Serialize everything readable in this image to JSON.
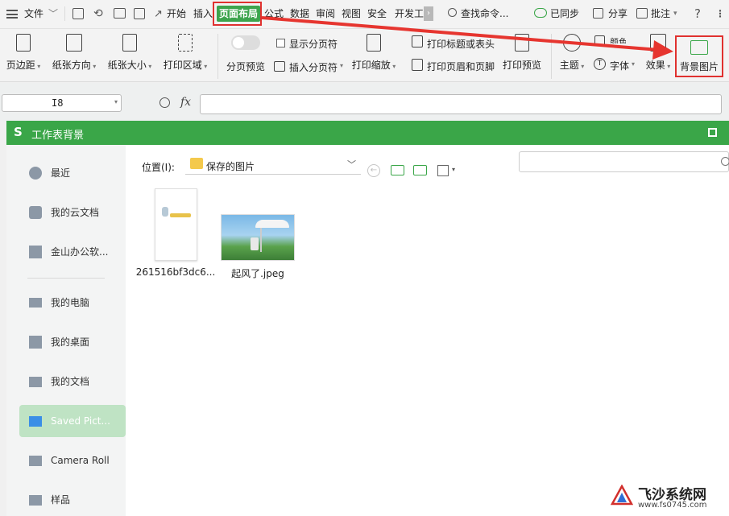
{
  "menu": {
    "file": "文件",
    "tabs": [
      "开始",
      "插入",
      "页面布局",
      "公式",
      "数据",
      "审阅",
      "视图",
      "安全",
      "开发工"
    ],
    "search": "查找命令...",
    "sync": "已同步",
    "share": "分享",
    "comment": "批注",
    "help": "?"
  },
  "ribbon": {
    "margins": "页边距",
    "orientation": "纸张方向",
    "size": "纸张大小",
    "print_area": "打印区域",
    "page_preview": "分页预览",
    "show_page_break": "显示分页符",
    "insert_page_break": "插入分页符",
    "print_scale": "打印缩放",
    "print_title": "打印标题或表头",
    "print_header_footer": "打印页眉和页脚",
    "print_preview": "打印预览",
    "theme": "主题",
    "font": "字体",
    "effect": "效果",
    "bg_image": "背景图片",
    "color_partial": "颜色"
  },
  "formula": {
    "cell_ref": "I8",
    "fx": "fx"
  },
  "dialog": {
    "title": "工作表背景",
    "location_label": "位置(I):",
    "location_value": "保存的图片",
    "side_items": [
      "最近",
      "我的云文档",
      "金山办公软...",
      "我的电脑",
      "我的桌面",
      "我的文档",
      "Saved Pict...",
      "Camera Roll",
      "样品"
    ],
    "files": [
      {
        "name": "261516bf3dc6..."
      },
      {
        "name": "起风了.jpeg"
      }
    ]
  },
  "watermark": {
    "brand": "飞沙系统网",
    "url": "www.fs0745.com"
  },
  "colors": {
    "accent": "#3aa648",
    "highlight": "#e0312f",
    "selected": "#bfe3c4"
  }
}
